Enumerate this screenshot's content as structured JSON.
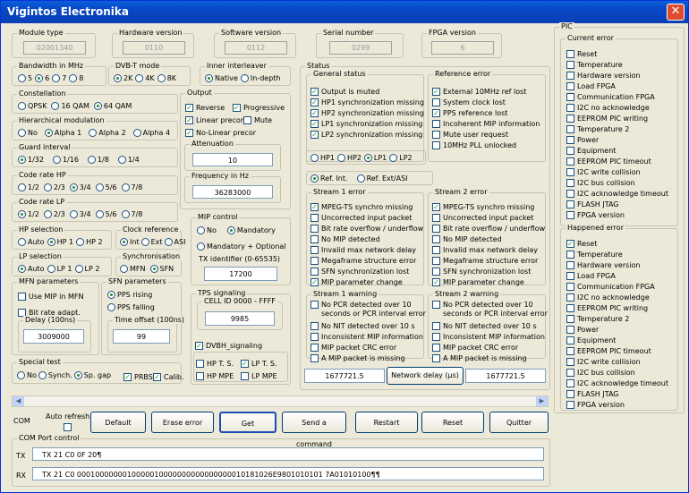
{
  "window": {
    "title": "Vigintos Electronika"
  },
  "info": {
    "module_type": {
      "label": "Module type",
      "value": "02001340"
    },
    "hardware": {
      "label": "Hardware version",
      "value": "0110"
    },
    "software": {
      "label": "Software version",
      "value": "0112"
    },
    "serial": {
      "label": "Serial number",
      "value": "0299"
    },
    "fpga": {
      "label": "FPGA version",
      "value": "6"
    }
  },
  "bandwidth": {
    "label": "Bandwidth in MHz",
    "options": [
      "5",
      "6",
      "7",
      "8"
    ],
    "selected": 1
  },
  "dvbt_mode": {
    "label": "DVB-T mode",
    "options": [
      "2K",
      "4K",
      "8K"
    ],
    "selected": 0
  },
  "inner_interleaver": {
    "label": "Inner interleaver",
    "options": [
      "Native",
      "In-depth"
    ],
    "selected": 0
  },
  "constellation": {
    "label": "Constellation",
    "options": [
      "QPSK",
      "16 QAM",
      "64 QAM"
    ],
    "selected": 2
  },
  "hierarchical": {
    "label": "Hierarchical modulation",
    "options": [
      "No",
      "Alpha 1",
      "Alpha 2",
      "Alpha 4"
    ],
    "selected": 1
  },
  "guard": {
    "label": "Guard interval",
    "options": [
      "1/32",
      "1/16",
      "1/8",
      "1/4"
    ],
    "selected": 0
  },
  "code_hp": {
    "label": "Code rate HP",
    "options": [
      "1/2",
      "2/3",
      "3/4",
      "5/6",
      "7/8"
    ],
    "selected": 2
  },
  "code_lp": {
    "label": "Code rate LP",
    "options": [
      "1/2",
      "2/3",
      "3/4",
      "5/6",
      "7/8"
    ],
    "selected": 0
  },
  "hp_sel": {
    "label": "HP selection",
    "options": [
      "Auto",
      "HP 1",
      "HP 2"
    ],
    "selected": 1
  },
  "clock_ref": {
    "label": "Clock reference",
    "options": [
      "Int",
      "Ext",
      "ASI"
    ],
    "selected": 0
  },
  "lp_sel": {
    "label": "LP selection",
    "options": [
      "Auto",
      "LP 1",
      "LP 2"
    ],
    "selected": 0
  },
  "sync": {
    "label": "Synchronisation",
    "options": [
      "MFN",
      "SFN"
    ],
    "selected": 1
  },
  "mfn": {
    "label": "MFN parameters",
    "use_mip": "Use MIP in MFN",
    "bitrate": "Bit rate adapt.",
    "delay_label": "Delay (100ns)",
    "delay_value": "3009000"
  },
  "sfn": {
    "label": "SFN parameters",
    "options": [
      "PPS rising",
      "PPS falling"
    ],
    "selected": 0,
    "offset_label": "Time offset (100ns)",
    "offset_value": "99"
  },
  "special": {
    "label": "Special test",
    "options": [
      "No",
      "Synch.",
      "Sp. gap"
    ],
    "selected": 2,
    "prbs": "PRBS",
    "calib": "Calib."
  },
  "output": {
    "label": "Output",
    "reverse": "Reverse",
    "progressive": "Progressive",
    "linear": "Linear precor",
    "mute": "Mute",
    "nolinear": "No-Linear precor",
    "atten_label": "Attenuation",
    "atten_value": "10",
    "freq_label": "Frequency in Hz",
    "freq_value": "36283000"
  },
  "mip_control": {
    "label": "MIP control",
    "options": [
      "No",
      "Mandatory",
      "Mandatory + Optional"
    ],
    "selected": 1,
    "tx_label": "TX identifier (0-65535)",
    "tx_value": "17200"
  },
  "tps": {
    "label": "TPS signaling",
    "cell_label": "CELL ID 0000 - FFFF",
    "cell_value": "9985",
    "dvbh": "DVBH_signaling",
    "hpts": "HP T. S.",
    "lpts": "LP T. S.",
    "hpmpe": "HP MPE",
    "lpmpe": "LP MPE"
  },
  "status": {
    "label": "Status",
    "general": {
      "label": "General status",
      "items": [
        {
          "t": "Output is muted",
          "c": true
        },
        {
          "t": "HP1 synchronization missing",
          "c": true
        },
        {
          "t": "HP2 synchronization missing",
          "c": true
        },
        {
          "t": "LP1 synchronization missing",
          "c": true
        },
        {
          "t": "LP2 synchronization missing",
          "c": true
        }
      ]
    },
    "reference": {
      "label": "Reference error",
      "items": [
        {
          "t": "External 10MHz ref lost",
          "c": true
        },
        {
          "t": "System clock lost",
          "c": false
        },
        {
          "t": "PPS reference lost",
          "c": true
        },
        {
          "t": "Incoherent MIP information",
          "c": false
        },
        {
          "t": "Mute user request",
          "c": false
        },
        {
          "t": "10MHz PLL unlocked",
          "c": false
        }
      ]
    },
    "stream_sel": {
      "options": [
        "HP1",
        "HP2",
        "LP1",
        "LP2"
      ],
      "selected": 2
    },
    "ref_sel": {
      "options": [
        "Ref. Int.",
        "Ref. Ext/ASI"
      ],
      "selected": 0
    },
    "s1err": {
      "label": "Stream 1 error",
      "items": [
        {
          "t": "MPEG-TS synchro missing",
          "c": true
        },
        {
          "t": "Uncorrected input packet",
          "c": false
        },
        {
          "t": "Bit rate overflow / underflow",
          "c": false
        },
        {
          "t": "No MIP detected",
          "c": false
        },
        {
          "t": "Invalid max network delay",
          "c": false
        },
        {
          "t": "Megaframe structure error",
          "c": false
        },
        {
          "t": "SFN synchronization lost",
          "c": false
        },
        {
          "t": "MIP parameter change",
          "c": true
        }
      ]
    },
    "s2err": {
      "label": "Stream 2 error",
      "items": [
        {
          "t": "MPEG-TS synchro missing",
          "c": true
        },
        {
          "t": "Uncorrected input packet",
          "c": false
        },
        {
          "t": "Bit rate overflow / underflow",
          "c": false
        },
        {
          "t": "No MIP detected",
          "c": false
        },
        {
          "t": "Invalid max network delay",
          "c": false
        },
        {
          "t": "Megaframe structure error",
          "c": false
        },
        {
          "t": "SFN synchronization lost",
          "c": false
        },
        {
          "t": "MIP parameter change",
          "c": true
        }
      ]
    },
    "s1warn": {
      "label": "Stream 1 warning",
      "items": [
        {
          "t": "No PCR detected over 10 seconds or PCR interval error",
          "c": false
        },
        {
          "t": "No NIT detected over 10 s",
          "c": false
        },
        {
          "t": "Inconsistent MIP information",
          "c": false
        },
        {
          "t": "MIP packet CRC error",
          "c": false
        },
        {
          "t": "A MIP packet is missing",
          "c": false
        }
      ]
    },
    "s2warn": {
      "label": "Stream 2 warning",
      "items": [
        {
          "t": "No PCR detected over 10 seconds or PCR interval error",
          "c": false
        },
        {
          "t": "No NIT detected over 10 s",
          "c": false
        },
        {
          "t": "Inconsistent MIP information",
          "c": false
        },
        {
          "t": "MIP packet CRC error",
          "c": false
        },
        {
          "t": "A MIP packet is missing",
          "c": false
        }
      ]
    },
    "delay1": "1677721.5",
    "delay_label": "Network delay (µs)",
    "delay2": "1677721.5"
  },
  "pic": {
    "label": "PIC",
    "current": {
      "label": "Current error",
      "items": [
        {
          "t": "Reset",
          "c": false
        },
        {
          "t": "Temperature",
          "c": false
        },
        {
          "t": "Hardware version",
          "c": false
        },
        {
          "t": "Load FPGA",
          "c": false
        },
        {
          "t": "Communication FPGA",
          "c": false
        },
        {
          "t": "I2C no acknowledge",
          "c": false
        },
        {
          "t": "EEPROM PIC writing",
          "c": false
        },
        {
          "t": "Temperature 2",
          "c": false
        },
        {
          "t": "Power",
          "c": false
        },
        {
          "t": "Equipment",
          "c": false
        },
        {
          "t": "EEPROM PIC timeout",
          "c": false
        },
        {
          "t": "I2C write collision",
          "c": false
        },
        {
          "t": "I2C bus collision",
          "c": false
        },
        {
          "t": "I2C acknowledge timeout",
          "c": false
        },
        {
          "t": "FLASH JTAG",
          "c": false
        },
        {
          "t": "FPGA version",
          "c": false
        }
      ]
    },
    "happened": {
      "label": "Happened error",
      "items": [
        {
          "t": "Reset",
          "c": true
        },
        {
          "t": "Temperature",
          "c": false
        },
        {
          "t": "Hardware version",
          "c": false
        },
        {
          "t": "Load FPGA",
          "c": false
        },
        {
          "t": "Communication FPGA",
          "c": false
        },
        {
          "t": "I2C no acknowledge",
          "c": false
        },
        {
          "t": "EEPROM PIC writing",
          "c": false
        },
        {
          "t": "Temperature 2",
          "c": false
        },
        {
          "t": "Power",
          "c": false
        },
        {
          "t": "Equipment",
          "c": false
        },
        {
          "t": "EEPROM PIC timeout",
          "c": false
        },
        {
          "t": "I2C write collision",
          "c": false
        },
        {
          "t": "I2C bus collision",
          "c": false
        },
        {
          "t": "I2C acknowledge timeout",
          "c": false
        },
        {
          "t": "FLASH JTAG",
          "c": false
        },
        {
          "t": "FPGA version",
          "c": false
        }
      ]
    }
  },
  "toolbar": {
    "com": "COM",
    "auto_refresh": "Auto refresh",
    "default": "Default",
    "erase": "Erase error",
    "get": "Get",
    "send": "Send a command",
    "restart": "Restart",
    "reset": "Reset",
    "quit": "Quitter"
  },
  "port": {
    "label": "COM Port control",
    "tx_label": "TX",
    "tx": "TX 21 C0 0F 20¶",
    "rx_label": "RX",
    "rx": "TX 21 C0 0001000000010000010000000000000000010181026E9801010101 7A01010100¶¶"
  }
}
